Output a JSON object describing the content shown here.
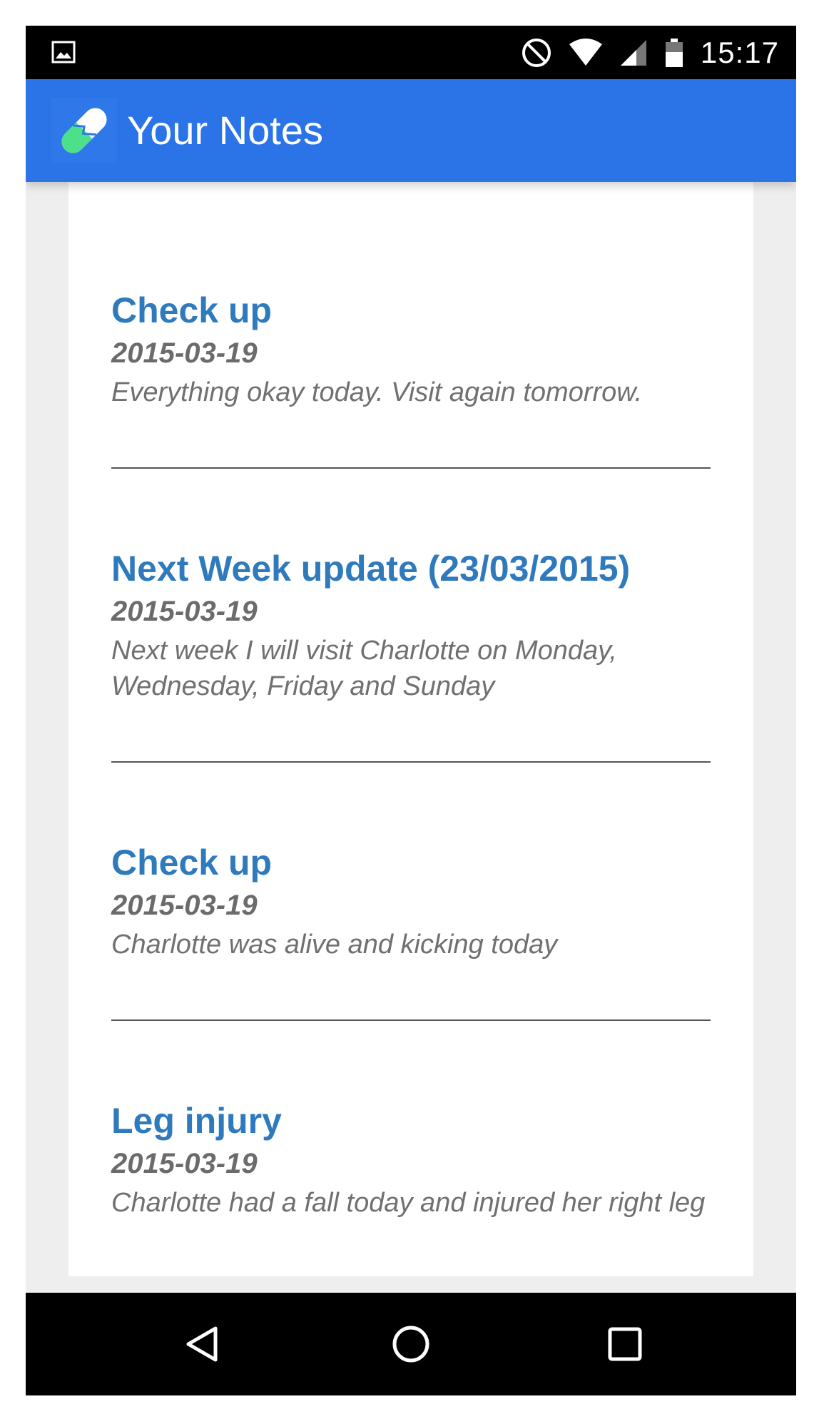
{
  "status_bar": {
    "time": "15:17",
    "icons": [
      "image-notification-icon",
      "do-not-disturb-icon",
      "wifi-icon",
      "cell-signal-icon",
      "battery-icon"
    ]
  },
  "app_bar": {
    "title": "Your Notes",
    "logo_icon": "pill-logo-icon",
    "color": "#2a74e8"
  },
  "notes": [
    {
      "title": "Check up",
      "date": "2015-03-19",
      "body": "Everything okay today. Visit again tomorrow."
    },
    {
      "title": "Next Week update (23/03/2015)",
      "date": "2015-03-19",
      "body": "Next week I will visit Charlotte on Monday, Wednesday, Friday and Sunday"
    },
    {
      "title": "Check up",
      "date": "2015-03-19",
      "body": "Charlotte was alive and kicking today"
    },
    {
      "title": "Leg injury",
      "date": "2015-03-19",
      "body": "Charlotte had a fall today and injured her right leg"
    }
  ],
  "nav_bar": {
    "buttons": [
      "back-icon",
      "home-icon",
      "recents-icon"
    ]
  },
  "colors": {
    "note_title": "#2f79bd",
    "accent_green": "#4ce08a"
  }
}
